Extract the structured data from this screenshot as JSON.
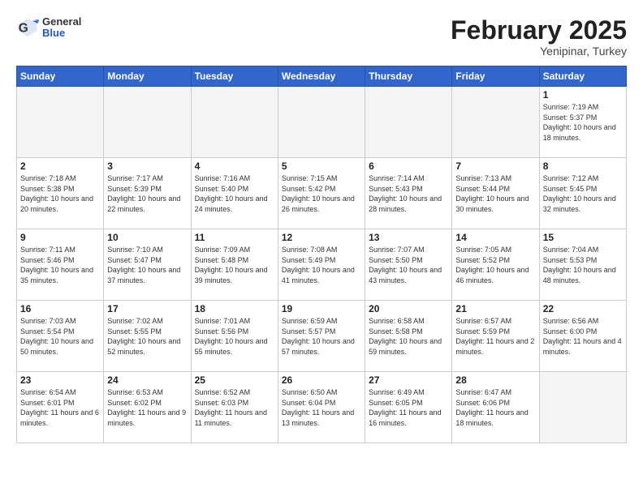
{
  "header": {
    "logo_general": "General",
    "logo_blue": "Blue",
    "title": "February 2025",
    "subtitle": "Yenipinar, Turkey"
  },
  "days_of_week": [
    "Sunday",
    "Monday",
    "Tuesday",
    "Wednesday",
    "Thursday",
    "Friday",
    "Saturday"
  ],
  "weeks": [
    [
      {
        "num": "",
        "info": ""
      },
      {
        "num": "",
        "info": ""
      },
      {
        "num": "",
        "info": ""
      },
      {
        "num": "",
        "info": ""
      },
      {
        "num": "",
        "info": ""
      },
      {
        "num": "",
        "info": ""
      },
      {
        "num": "1",
        "info": "Sunrise: 7:19 AM\nSunset: 5:37 PM\nDaylight: 10 hours and 18 minutes."
      }
    ],
    [
      {
        "num": "2",
        "info": "Sunrise: 7:18 AM\nSunset: 5:38 PM\nDaylight: 10 hours and 20 minutes."
      },
      {
        "num": "3",
        "info": "Sunrise: 7:17 AM\nSunset: 5:39 PM\nDaylight: 10 hours and 22 minutes."
      },
      {
        "num": "4",
        "info": "Sunrise: 7:16 AM\nSunset: 5:40 PM\nDaylight: 10 hours and 24 minutes."
      },
      {
        "num": "5",
        "info": "Sunrise: 7:15 AM\nSunset: 5:42 PM\nDaylight: 10 hours and 26 minutes."
      },
      {
        "num": "6",
        "info": "Sunrise: 7:14 AM\nSunset: 5:43 PM\nDaylight: 10 hours and 28 minutes."
      },
      {
        "num": "7",
        "info": "Sunrise: 7:13 AM\nSunset: 5:44 PM\nDaylight: 10 hours and 30 minutes."
      },
      {
        "num": "8",
        "info": "Sunrise: 7:12 AM\nSunset: 5:45 PM\nDaylight: 10 hours and 32 minutes."
      }
    ],
    [
      {
        "num": "9",
        "info": "Sunrise: 7:11 AM\nSunset: 5:46 PM\nDaylight: 10 hours and 35 minutes."
      },
      {
        "num": "10",
        "info": "Sunrise: 7:10 AM\nSunset: 5:47 PM\nDaylight: 10 hours and 37 minutes."
      },
      {
        "num": "11",
        "info": "Sunrise: 7:09 AM\nSunset: 5:48 PM\nDaylight: 10 hours and 39 minutes."
      },
      {
        "num": "12",
        "info": "Sunrise: 7:08 AM\nSunset: 5:49 PM\nDaylight: 10 hours and 41 minutes."
      },
      {
        "num": "13",
        "info": "Sunrise: 7:07 AM\nSunset: 5:50 PM\nDaylight: 10 hours and 43 minutes."
      },
      {
        "num": "14",
        "info": "Sunrise: 7:05 AM\nSunset: 5:52 PM\nDaylight: 10 hours and 46 minutes."
      },
      {
        "num": "15",
        "info": "Sunrise: 7:04 AM\nSunset: 5:53 PM\nDaylight: 10 hours and 48 minutes."
      }
    ],
    [
      {
        "num": "16",
        "info": "Sunrise: 7:03 AM\nSunset: 5:54 PM\nDaylight: 10 hours and 50 minutes."
      },
      {
        "num": "17",
        "info": "Sunrise: 7:02 AM\nSunset: 5:55 PM\nDaylight: 10 hours and 52 minutes."
      },
      {
        "num": "18",
        "info": "Sunrise: 7:01 AM\nSunset: 5:56 PM\nDaylight: 10 hours and 55 minutes."
      },
      {
        "num": "19",
        "info": "Sunrise: 6:59 AM\nSunset: 5:57 PM\nDaylight: 10 hours and 57 minutes."
      },
      {
        "num": "20",
        "info": "Sunrise: 6:58 AM\nSunset: 5:58 PM\nDaylight: 10 hours and 59 minutes."
      },
      {
        "num": "21",
        "info": "Sunrise: 6:57 AM\nSunset: 5:59 PM\nDaylight: 11 hours and 2 minutes."
      },
      {
        "num": "22",
        "info": "Sunrise: 6:56 AM\nSunset: 6:00 PM\nDaylight: 11 hours and 4 minutes."
      }
    ],
    [
      {
        "num": "23",
        "info": "Sunrise: 6:54 AM\nSunset: 6:01 PM\nDaylight: 11 hours and 6 minutes."
      },
      {
        "num": "24",
        "info": "Sunrise: 6:53 AM\nSunset: 6:02 PM\nDaylight: 11 hours and 9 minutes."
      },
      {
        "num": "25",
        "info": "Sunrise: 6:52 AM\nSunset: 6:03 PM\nDaylight: 11 hours and 11 minutes."
      },
      {
        "num": "26",
        "info": "Sunrise: 6:50 AM\nSunset: 6:04 PM\nDaylight: 11 hours and 13 minutes."
      },
      {
        "num": "27",
        "info": "Sunrise: 6:49 AM\nSunset: 6:05 PM\nDaylight: 11 hours and 16 minutes."
      },
      {
        "num": "28",
        "info": "Sunrise: 6:47 AM\nSunset: 6:06 PM\nDaylight: 11 hours and 18 minutes."
      },
      {
        "num": "",
        "info": ""
      }
    ]
  ]
}
